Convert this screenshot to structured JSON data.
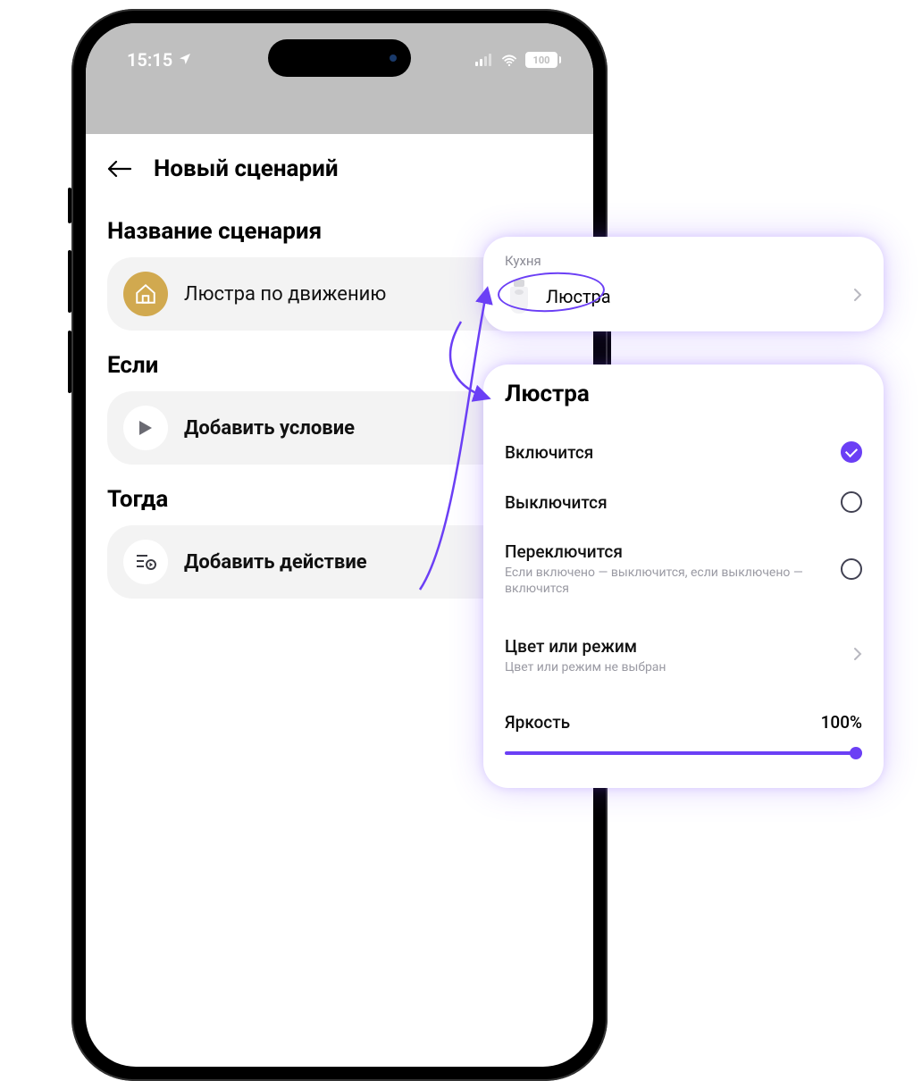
{
  "statusbar": {
    "time": "15:15",
    "battery": "100"
  },
  "header": {
    "title": "Новый сценарий"
  },
  "sections": {
    "name_title": "Название сценария",
    "name_value": "Люстра по движению",
    "if_title": "Если",
    "if_action": "Добавить условие",
    "then_title": "Тогда",
    "then_action": "Добавить действие"
  },
  "device_popout": {
    "room": "Кухня",
    "device_name": "Люстра"
  },
  "actions_popout": {
    "title": "Люстра",
    "options": {
      "turn_on": "Включится",
      "turn_off": "Выключится",
      "toggle": "Переключится",
      "toggle_sub": "Если включено — выключится, если выключено — включится",
      "color": "Цвет или режим",
      "color_sub": "Цвет или режим не выбран",
      "brightness": "Яркость",
      "brightness_value": "100%"
    }
  },
  "colors": {
    "accent": "#6b3ff5",
    "gold": "#d1a94f"
  }
}
